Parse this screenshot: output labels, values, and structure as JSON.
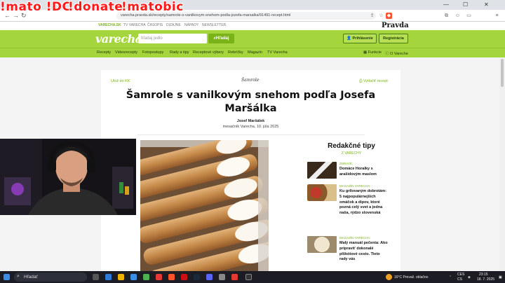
{
  "overlay": {
    "cmd1": "!mato !DC",
    "cmd2": "!donate",
    "cmd3": "!matobic"
  },
  "browser": {
    "url": "varecha.pravda.sk/recepty/samrole-s-vanilkovym-snehom-podla-jozefa-marsalka/91491-recept.html"
  },
  "site": {
    "topnav": [
      "VARECHA.SK",
      "TV VARECHA",
      "ČASOPIS",
      "DIZAJNE",
      "NÁPADY",
      "NEWSLETTER"
    ],
    "logo": "varecha",
    "search_placeholder": "hľadaj jedlo",
    "search_button": "Hľadaj",
    "brand": "Pravda",
    "login": "Prihlásenie",
    "register": "Registrácia",
    "categories": [
      "Recepty",
      "Videorecepty",
      "Fotopostupy",
      "Rady a tipy",
      "Receptové výbery",
      "Rebríčky",
      "Magazín",
      "TV Varecha"
    ],
    "right_links": [
      "Funkcie",
      "O Vareche"
    ]
  },
  "article": {
    "save": "Ulož do KK",
    "print": "Vytlačiť recept",
    "brandmark": "Šamrole",
    "title": "Šamrole s vanilkovým snehom podľa Josefa Maršálka",
    "author": "Josef Maršálek",
    "date": "mesačník Varecha, 10. júla 2025"
  },
  "sidebar": {
    "title": "Redakčné tipy",
    "subtitle": "Z VARECHY",
    "tips": [
      {
        "tag": "ZDRAVÉ:",
        "text": "Domáce Horalky s arašidovým maslom"
      },
      {
        "tag": "MAGAZÍN VARECHA:",
        "text": "Ku grilovaným dobrotám: 5 najpopulárnejších omáčok a dipov, ktoré pozná celý svet a jedna naša, rýdzo slovenská"
      },
      {
        "tag": "MAGAZÍN VARECHA:",
        "text": "Malý manuál pečenia: Ako pripraviť dokonalé plškótové cesto. Tieto rady vás"
      }
    ]
  },
  "taskbar": {
    "search": "Hľadať",
    "weather": "16°C Prevaž. oblačno",
    "lang": "CES",
    "lang2": "CS",
    "time": "23:15",
    "date": "18. 7. 2025"
  }
}
